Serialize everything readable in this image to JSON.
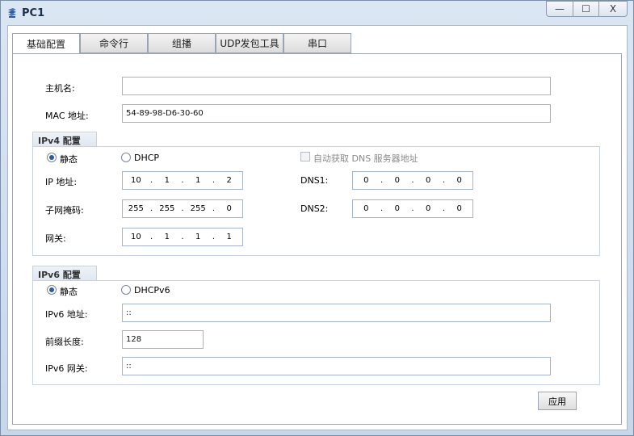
{
  "window": {
    "title": "PC1",
    "minimize_symbol": "—",
    "maximize_symbol": "☐",
    "close_symbol": "X"
  },
  "tabs": [
    {
      "label": "基础配置"
    },
    {
      "label": "命令行"
    },
    {
      "label": "组播"
    },
    {
      "label": "UDP发包工具"
    },
    {
      "label": "串口"
    }
  ],
  "basic": {
    "hostname_label": "主机名:",
    "hostname_value": "",
    "mac_label": "MAC 地址:",
    "mac_value": "54-89-98-D6-30-60"
  },
  "ipv4": {
    "group_title": "IPv4 配置",
    "static_label": "静态",
    "dhcp_label": "DHCP",
    "auto_dns_label": "自动获取 DNS 服务器地址",
    "ip_label": "IP 地址:",
    "ip": [
      "10",
      "1",
      "1",
      "2"
    ],
    "mask_label": "子网掩码:",
    "mask": [
      "255",
      "255",
      "255",
      "0"
    ],
    "gateway_label": "网关:",
    "gateway": [
      "10",
      "1",
      "1",
      "1"
    ],
    "dns1_label": "DNS1:",
    "dns1": [
      "0",
      "0",
      "0",
      "0"
    ],
    "dns2_label": "DNS2:",
    "dns2": [
      "0",
      "0",
      "0",
      "0"
    ],
    "dot": "."
  },
  "ipv6": {
    "group_title": "IPv6 配置",
    "static_label": "静态",
    "dhcp_label": "DHCPv6",
    "ip_label": "IPv6 地址:",
    "ip_value": "::",
    "prefix_label": "前缀长度:",
    "prefix_value": "128",
    "gateway_label": "IPv6 网关:",
    "gateway_value": "::"
  },
  "apply_label": "应用",
  "icons": {
    "app": "network-pc-icon",
    "radio": "radio-icon",
    "checkbox": "checkbox-icon"
  }
}
